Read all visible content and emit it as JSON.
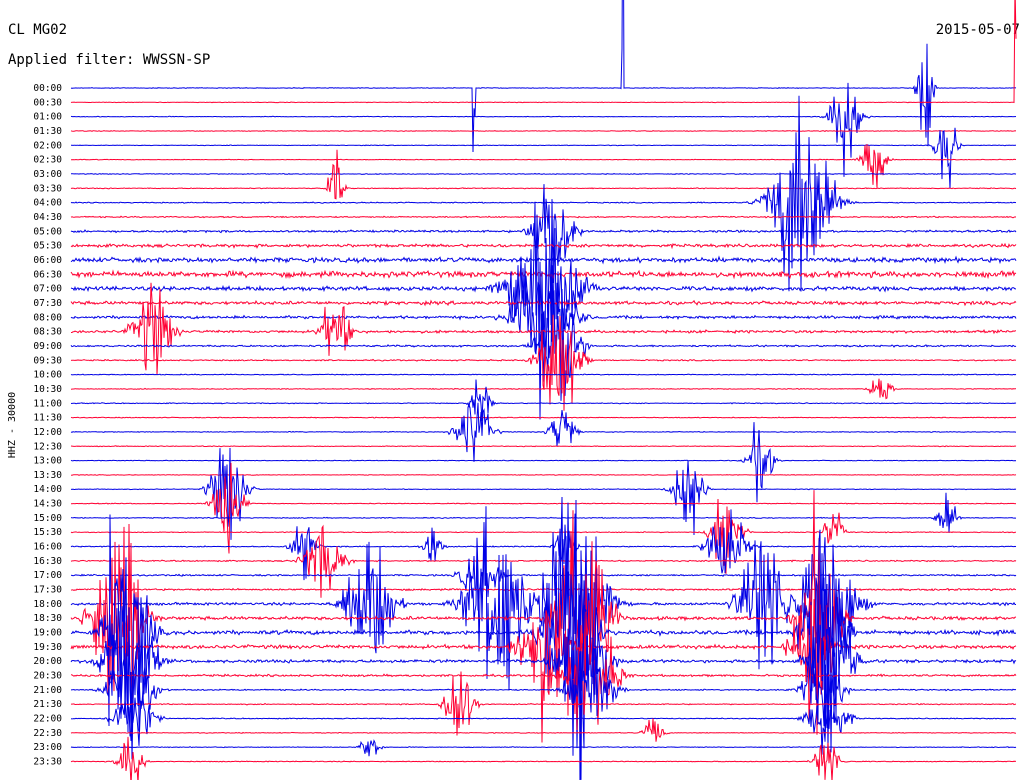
{
  "chart_data": {
    "type": "line",
    "title": "CL MG02",
    "subtitle": "Applied filter: WWSSN-SP",
    "date": "2015-05-07",
    "ylabel": "HHZ - 30000",
    "xlabel": "",
    "x_range_minutes": [
      0,
      30
    ],
    "grid": false,
    "legend": "none",
    "colors": {
      "traceA": "#0000e6",
      "traceB": "#ff0033",
      "text": "#000000"
    },
    "row_labels": [
      "00:00",
      "00:30",
      "01:00",
      "01:30",
      "02:00",
      "02:30",
      "03:00",
      "03:30",
      "04:00",
      "04:30",
      "05:00",
      "05:30",
      "06:00",
      "06:30",
      "07:00",
      "07:30",
      "08:00",
      "08:30",
      "09:00",
      "09:30",
      "10:00",
      "10:30",
      "11:00",
      "11:30",
      "12:00",
      "12:30",
      "13:00",
      "13:30",
      "14:00",
      "14:30",
      "15:00",
      "15:30",
      "16:00",
      "16:30",
      "17:00",
      "17:30",
      "18:00",
      "18:30",
      "19:00",
      "19:30",
      "20:00",
      "20:30",
      "21:00",
      "21:30",
      "22:00",
      "22:30",
      "23:00",
      "23:30"
    ],
    "row_color_cycle": [
      "blue",
      "red"
    ],
    "row_noise_level": [
      0.25,
      0.25,
      0.25,
      0.25,
      0.25,
      0.25,
      0.3,
      0.35,
      0.4,
      0.5,
      0.8,
      1.2,
      1.8,
      2.2,
      1.6,
      1.3,
      1.1,
      1.0,
      0.7,
      0.5,
      0.35,
      0.3,
      0.35,
      0.3,
      0.3,
      0.3,
      0.25,
      0.25,
      0.3,
      0.3,
      0.35,
      0.35,
      0.4,
      0.5,
      0.6,
      0.7,
      1.0,
      1.3,
      1.6,
      1.4,
      1.2,
      0.8,
      0.5,
      0.4,
      0.35,
      0.3,
      0.3,
      0.3
    ],
    "events": [
      {
        "row": 0,
        "minute": 12.8,
        "amp": 120,
        "width": 0.05
      },
      {
        "row": 0,
        "minute": 17.5,
        "amp": 200,
        "width": 0.05
      },
      {
        "row": 0,
        "minute": 27.1,
        "amp": 60,
        "width": 0.3
      },
      {
        "row": 1,
        "minute": 30.0,
        "amp": 100,
        "width": 0.05
      },
      {
        "row": 2,
        "minute": 24.6,
        "amp": 45,
        "width": 0.6
      },
      {
        "row": 4,
        "minute": 27.8,
        "amp": 40,
        "width": 0.4
      },
      {
        "row": 5,
        "minute": 25.5,
        "amp": 25,
        "width": 0.5
      },
      {
        "row": 7,
        "minute": 8.4,
        "amp": 30,
        "width": 0.3
      },
      {
        "row": 8,
        "minute": 23.2,
        "amp": 90,
        "width": 1.2
      },
      {
        "row": 10,
        "minute": 15.3,
        "amp": 60,
        "width": 0.8
      },
      {
        "row": 14,
        "minute": 15.0,
        "amp": 70,
        "width": 1.5
      },
      {
        "row": 16,
        "minute": 15.0,
        "amp": 60,
        "width": 1.2
      },
      {
        "row": 17,
        "minute": 2.6,
        "amp": 40,
        "width": 0.8
      },
      {
        "row": 17,
        "minute": 8.4,
        "amp": 30,
        "width": 0.6
      },
      {
        "row": 18,
        "minute": 15.5,
        "amp": 70,
        "width": 0.8
      },
      {
        "row": 19,
        "minute": 15.5,
        "amp": 60,
        "width": 0.8
      },
      {
        "row": 21,
        "minute": 25.7,
        "amp": 18,
        "width": 0.4
      },
      {
        "row": 22,
        "minute": 13.0,
        "amp": 25,
        "width": 0.4
      },
      {
        "row": 24,
        "minute": 12.8,
        "amp": 30,
        "width": 0.7
      },
      {
        "row": 24,
        "minute": 15.6,
        "amp": 25,
        "width": 0.5
      },
      {
        "row": 26,
        "minute": 21.9,
        "amp": 35,
        "width": 0.5
      },
      {
        "row": 28,
        "minute": 19.6,
        "amp": 40,
        "width": 0.6
      },
      {
        "row": 28,
        "minute": 5.0,
        "amp": 45,
        "width": 0.7
      },
      {
        "row": 29,
        "minute": 5.0,
        "amp": 35,
        "width": 0.6
      },
      {
        "row": 30,
        "minute": 27.8,
        "amp": 22,
        "width": 0.4
      },
      {
        "row": 31,
        "minute": 20.8,
        "amp": 45,
        "width": 0.6
      },
      {
        "row": 31,
        "minute": 24.2,
        "amp": 20,
        "width": 0.4
      },
      {
        "row": 32,
        "minute": 7.4,
        "amp": 25,
        "width": 0.5
      },
      {
        "row": 32,
        "minute": 11.5,
        "amp": 18,
        "width": 0.4
      },
      {
        "row": 32,
        "minute": 15.7,
        "amp": 22,
        "width": 0.4
      },
      {
        "row": 32,
        "minute": 20.8,
        "amp": 35,
        "width": 0.8
      },
      {
        "row": 33,
        "minute": 8.0,
        "amp": 30,
        "width": 0.8
      },
      {
        "row": 34,
        "minute": 13.0,
        "amp": 25,
        "width": 0.8
      },
      {
        "row": 36,
        "minute": 1.2,
        "amp": 160,
        "width": 0.05
      },
      {
        "row": 36,
        "minute": 9.5,
        "amp": 55,
        "width": 1.0
      },
      {
        "row": 36,
        "minute": 13.5,
        "amp": 90,
        "width": 1.2
      },
      {
        "row": 36,
        "minute": 16.0,
        "amp": 110,
        "width": 1.3
      },
      {
        "row": 36,
        "minute": 22.0,
        "amp": 70,
        "width": 1.0
      },
      {
        "row": 36,
        "minute": 24.0,
        "amp": 60,
        "width": 1.2
      },
      {
        "row": 37,
        "minute": 1.5,
        "amp": 110,
        "width": 1.0
      },
      {
        "row": 37,
        "minute": 16.3,
        "amp": 110,
        "width": 1.0
      },
      {
        "row": 37,
        "minute": 23.8,
        "amp": 90,
        "width": 0.8
      },
      {
        "row": 38,
        "minute": 1.8,
        "amp": 90,
        "width": 0.9
      },
      {
        "row": 38,
        "minute": 15.8,
        "amp": 120,
        "width": 1.0
      },
      {
        "row": 38,
        "minute": 23.9,
        "amp": 120,
        "width": 0.8
      },
      {
        "row": 39,
        "minute": 15.0,
        "amp": 60,
        "width": 1.0
      },
      {
        "row": 39,
        "minute": 23.5,
        "amp": 55,
        "width": 0.8
      },
      {
        "row": 40,
        "minute": 1.8,
        "amp": 75,
        "width": 1.0
      },
      {
        "row": 40,
        "minute": 16.2,
        "amp": 80,
        "width": 1.0
      },
      {
        "row": 40,
        "minute": 24.1,
        "amp": 80,
        "width": 0.9
      },
      {
        "row": 41,
        "minute": 16.5,
        "amp": 60,
        "width": 1.0
      },
      {
        "row": 42,
        "minute": 1.9,
        "amp": 50,
        "width": 0.9
      },
      {
        "row": 42,
        "minute": 16.5,
        "amp": 50,
        "width": 0.9
      },
      {
        "row": 42,
        "minute": 23.8,
        "amp": 45,
        "width": 0.8
      },
      {
        "row": 43,
        "minute": 12.3,
        "amp": 40,
        "width": 0.6
      },
      {
        "row": 44,
        "minute": 2.0,
        "amp": 30,
        "width": 0.8
      },
      {
        "row": 44,
        "minute": 24.0,
        "amp": 30,
        "width": 0.8
      },
      {
        "row": 45,
        "minute": 18.5,
        "amp": 15,
        "width": 0.4
      },
      {
        "row": 46,
        "minute": 9.5,
        "amp": 14,
        "width": 0.4
      },
      {
        "row": 47,
        "minute": 1.9,
        "amp": 25,
        "width": 0.5
      },
      {
        "row": 47,
        "minute": 24.0,
        "amp": 25,
        "width": 0.5
      }
    ]
  }
}
